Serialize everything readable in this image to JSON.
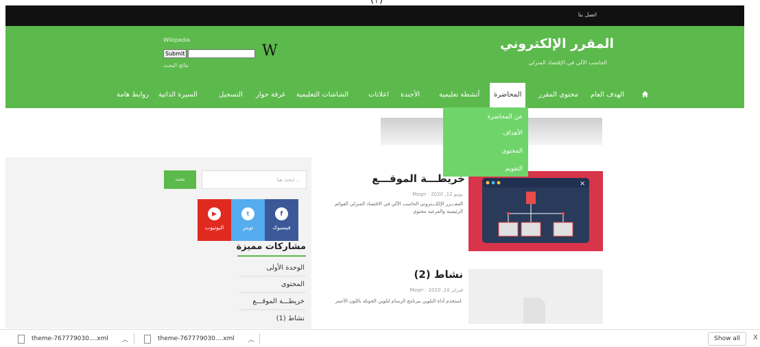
{
  "top_fragment": "(?)",
  "topbar": {
    "contact": "اتصل بنا"
  },
  "header": {
    "title": "المقرر الإلكتروني",
    "subtitle": "الحاسب الآلي في الإقتصاد المنزلي",
    "wiki": {
      "label": "Wikipedia",
      "submit": "Submit",
      "input_value": "",
      "results": "نتائج البحث",
      "logo_letter": "W"
    }
  },
  "nav": {
    "items": [
      "الهدف العام",
      "محتوى المقرر",
      "المحاضرة",
      "أنشطة تعليمية",
      "الأجندة",
      "اعلانات",
      "الشاشات التعليمية",
      "غرفة حوار",
      "التسجيل",
      "السيرة الذاتية",
      "روابط هامة"
    ],
    "active_index": 2,
    "home_icon": "home-icon"
  },
  "dropdown": {
    "items": [
      "عن المحاضرة",
      "الأهداف",
      "المحتوى",
      "التقويم"
    ]
  },
  "sidebar": {
    "search_placeholder": "ابحث هنا ...",
    "search_button": "بحث",
    "social": [
      {
        "label": "فيسبوك",
        "icon_char": "f",
        "color": "#3b5998",
        "icon": "facebook-icon"
      },
      {
        "label": "تويتر",
        "icon_char": "t",
        "color": "#55acee",
        "icon": "twitter-icon"
      },
      {
        "label": "اليوتيوب",
        "icon_char": "▶",
        "color": "#e02a20",
        "icon": "youtube-icon"
      }
    ],
    "featured_title": "مشاركات مميزة",
    "featured_items": [
      "الوحدة الأولى",
      "المحتوى",
      "خريطـــة الموقـــع",
      "نشاط (1)"
    ]
  },
  "posts": [
    {
      "title": "خريطـــة الموقـــع",
      "author": "Moqrr",
      "date": "يونيو 12, 2020",
      "excerpt": "المقـــرر الإلكـــتروني الحاسب الآلي في الاقتصاد المنزلي القوائم الرئيسية والفرعية محتوي"
    },
    {
      "title": "نشاط (2)",
      "author": "Moqrr",
      "date": "فبراير 10, 2020",
      "excerpt": "استخدم أداة التلوين ببرنامج الرسام لتلوين الجونلة باللون الأحمر."
    }
  ],
  "downloads": {
    "items": [
      "theme-767779030....xml",
      "theme-767779030....xml"
    ],
    "show_all": "Show all",
    "close": "X"
  },
  "colors": {
    "green": "#5cb94c",
    "dropdown_green": "#6fd56a",
    "topbar": "#111111"
  }
}
